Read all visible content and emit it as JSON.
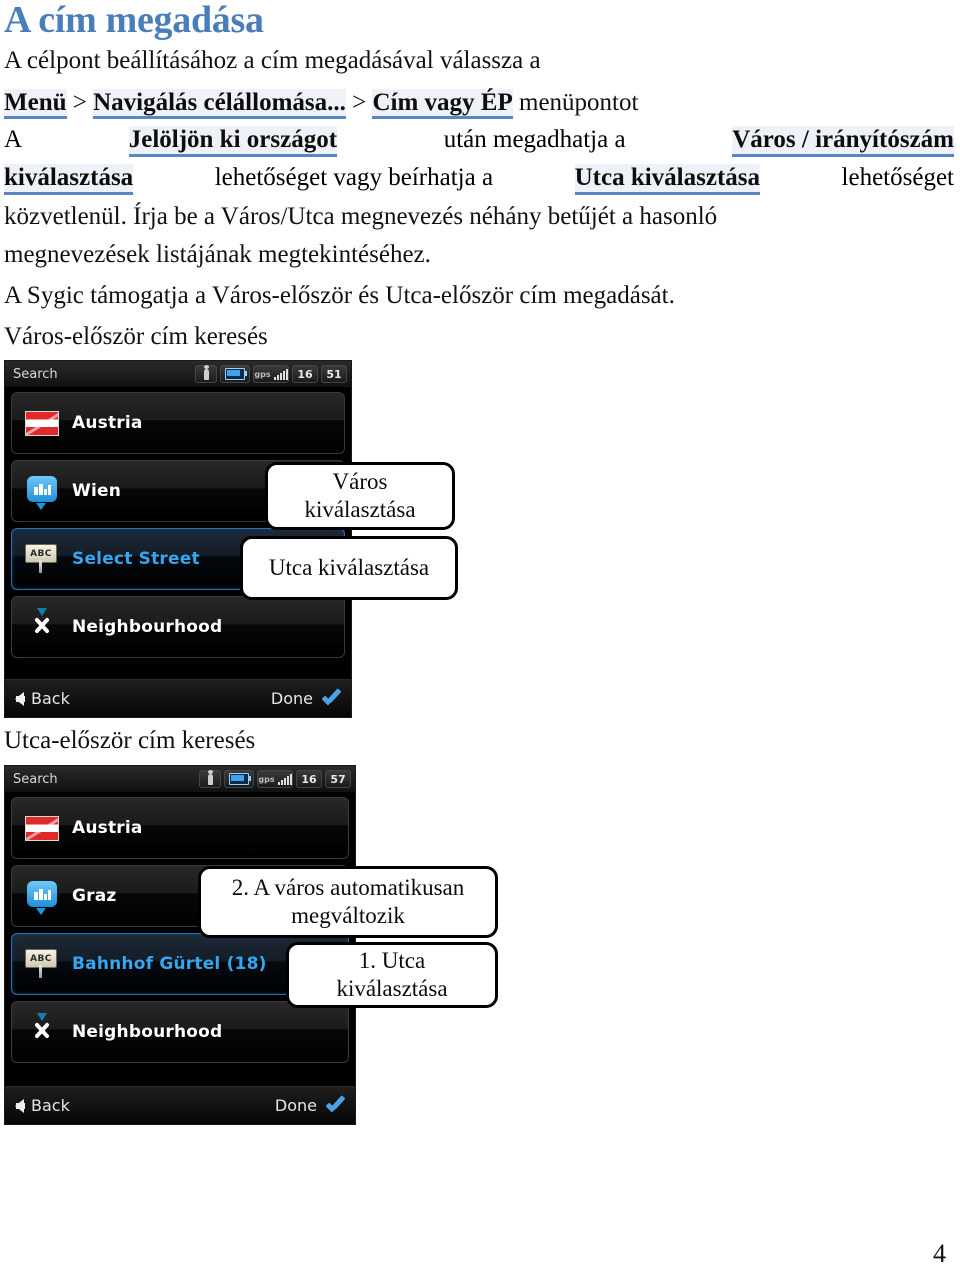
{
  "document": {
    "title": "A cím megadása",
    "page_number": "4",
    "paragraph1": {
      "line1": "A célpont beállításához a cím megadásával válassza a",
      "line2_parts": [
        {
          "text": "Menü",
          "style": "menuref"
        },
        {
          "text": " > ",
          "style": "plain"
        },
        {
          "text": "Navigálás célállomása...",
          "style": "menuref"
        },
        {
          "text": " > ",
          "style": "plain"
        },
        {
          "text": "Cím vagy ÉP",
          "style": "menuref"
        },
        {
          "text": " menüpontot",
          "style": "plain"
        }
      ],
      "line3_parts": [
        {
          "text": "A ",
          "style": "plain"
        },
        {
          "text": "Jelöljön ki országot",
          "style": "menuref"
        },
        {
          "text": " után megadhatja a ",
          "style": "plain"
        },
        {
          "text": "Város / irányítószám",
          "style": "menuref"
        }
      ],
      "line4_parts": [
        {
          "text": "kiválasztása",
          "style": "menuref"
        },
        {
          "text": " lehetőséget vagy beírhatja a ",
          "style": "plain"
        },
        {
          "text": "Utca kiválasztása",
          "style": "menuref"
        },
        {
          "text": " lehetőséget",
          "style": "plain"
        }
      ],
      "line5": "közvetlenül. Írja be a Város/Utca megnevezés néhány betűjét a hasonló",
      "line6": "megnevezések listájának megtekintéséhez.",
      "line7": "A Sygic támogatja a Város-először és Utca-először cím megadását."
    },
    "subheading_city_first": "Város-először cím keresés",
    "subheading_street_first": "Utca-először cím keresés"
  },
  "screenshot_city_first": {
    "statusbar": {
      "title": "Search",
      "icons": [
        "person-icon",
        "battery-icon",
        "gps-signal-icon"
      ],
      "value_left": "16",
      "value_right": "51"
    },
    "rows": [
      {
        "icon": "austria-flag-icon",
        "label": "Austria",
        "selected": false
      },
      {
        "icon": "city-pin-icon",
        "label": "Wien",
        "selected": false
      },
      {
        "icon": "abc-street-sign-icon",
        "label": "Select Street",
        "selected": true
      },
      {
        "icon": "neighbourhood-pin-icon",
        "label": "Neighbourhood",
        "selected": false
      }
    ],
    "footer": {
      "back_label": "Back",
      "done_label": "Done"
    }
  },
  "screenshot_street_first": {
    "statusbar": {
      "title": "Search",
      "icons": [
        "person-icon",
        "battery-icon",
        "gps-signal-icon"
      ],
      "value_left": "16",
      "value_right": "57"
    },
    "rows": [
      {
        "icon": "austria-flag-icon",
        "label": "Austria",
        "selected": false
      },
      {
        "icon": "city-pin-icon",
        "label": "Graz",
        "selected": false
      },
      {
        "icon": "abc-street-sign-icon",
        "label": "Bahnhof Gürtel (18)",
        "selected": true
      },
      {
        "icon": "neighbourhood-pin-icon",
        "label": "Neighbourhood",
        "selected": false
      }
    ],
    "footer": {
      "back_label": "Back",
      "done_label": "Done"
    }
  },
  "callouts": {
    "city_select": "Város kiválasztása",
    "street_select": "Utca kiválasztása",
    "city_auto_changes": "2. A város automatikusan megváltozik",
    "street_select_numbered": "1. Utca kiválasztása"
  },
  "colors": {
    "heading_blue": "#4a7ebb",
    "menuref_underline": "#5b86c4",
    "menuref_background": "#eef1f7",
    "device_background": "#000000",
    "selected_row_text": "#35a6ef",
    "done_check": "#4aa3e8"
  }
}
